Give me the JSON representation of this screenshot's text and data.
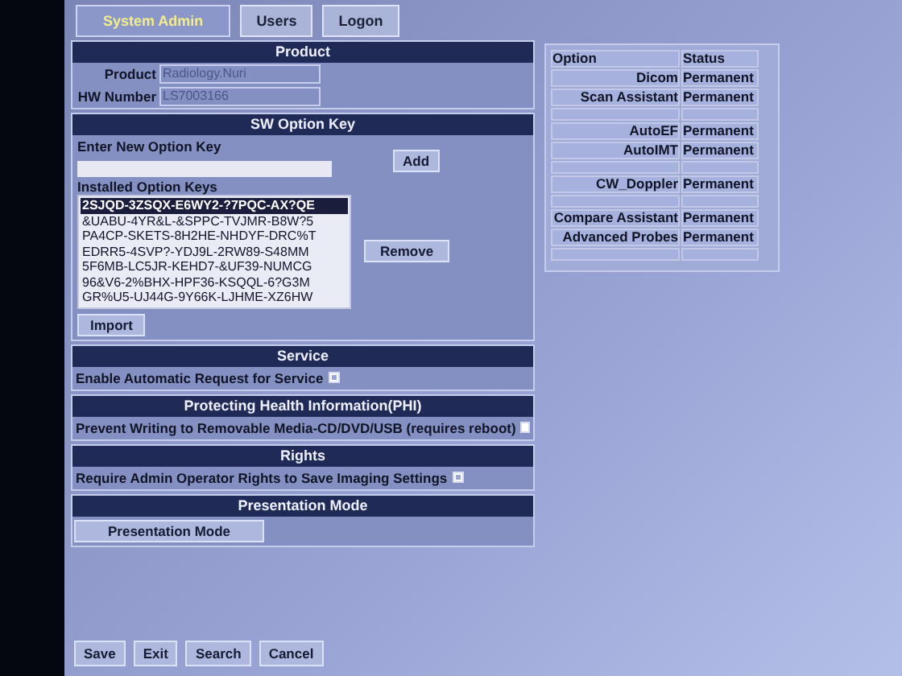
{
  "tabs": [
    {
      "label": "System Admin",
      "selected": true
    },
    {
      "label": "Users",
      "selected": false
    },
    {
      "label": "Logon",
      "selected": false
    }
  ],
  "product": {
    "title": "Product",
    "fields": [
      {
        "label": "Product",
        "value": "Radiology.Nuri"
      },
      {
        "label": "HW Number",
        "value": "LS7003166"
      }
    ]
  },
  "sw_option_key": {
    "title": "SW Option Key",
    "new_key_label": "Enter New Option Key",
    "add_button": "Add",
    "installed_label": "Installed Option Keys",
    "remove_button": "Remove",
    "import_button": "Import",
    "keys": [
      {
        "text": "2SJQD-3ZSQX-E6WY2-?7PQC-AX?QE",
        "selected": true
      },
      {
        "text": "&UABU-4YR&L-&SPPC-TVJMR-B8W?5",
        "selected": false
      },
      {
        "text": "PA4CP-SKETS-8H2HE-NHDYF-DRC%T",
        "selected": false
      },
      {
        "text": "EDRR5-4SVP?-YDJ9L-2RW89-S48MM",
        "selected": false
      },
      {
        "text": "5F6MB-LC5JR-KEHD7-&UF39-NUMCG",
        "selected": false
      },
      {
        "text": "96&V6-2%BHX-HPF36-KSQQL-6?G3M",
        "selected": false
      },
      {
        "text": "GR%U5-UJ44G-9Y66K-LJHME-XZ6HW",
        "selected": false
      }
    ]
  },
  "sections": [
    {
      "title": "Service",
      "label": "Enable Automatic Request for Service",
      "checked": true
    },
    {
      "title": "Protecting Health Information(PHI)",
      "label": "Prevent Writing to Removable Media-CD/DVD/USB (requires reboot)",
      "checked": false
    },
    {
      "title": "Rights",
      "label": "Require Admin Operator Rights to Save Imaging Settings",
      "checked": true
    }
  ],
  "presentation": {
    "title": "Presentation Mode",
    "button": "Presentation Mode"
  },
  "options_table": {
    "columns": [
      "Option",
      "Status"
    ],
    "rows": [
      {
        "kind": "option",
        "option": "Dicom",
        "status": "Permanent"
      },
      {
        "kind": "option",
        "option": "Scan Assistant",
        "status": "Permanent"
      },
      {
        "kind": "blank"
      },
      {
        "kind": "option",
        "option": "AutoEF",
        "status": "Permanent"
      },
      {
        "kind": "option",
        "option": "AutoIMT",
        "status": "Permanent"
      },
      {
        "kind": "blank"
      },
      {
        "kind": "option",
        "option": "CW_Doppler",
        "status": "Permanent"
      },
      {
        "kind": "blank"
      },
      {
        "kind": "option",
        "option": "Compare Assistant",
        "status": "Permanent"
      },
      {
        "kind": "option",
        "option": "Advanced Probes",
        "status": "Permanent"
      },
      {
        "kind": "blank"
      }
    ]
  },
  "buttons": [
    "Save",
    "Exit",
    "Search",
    "Cancel"
  ]
}
